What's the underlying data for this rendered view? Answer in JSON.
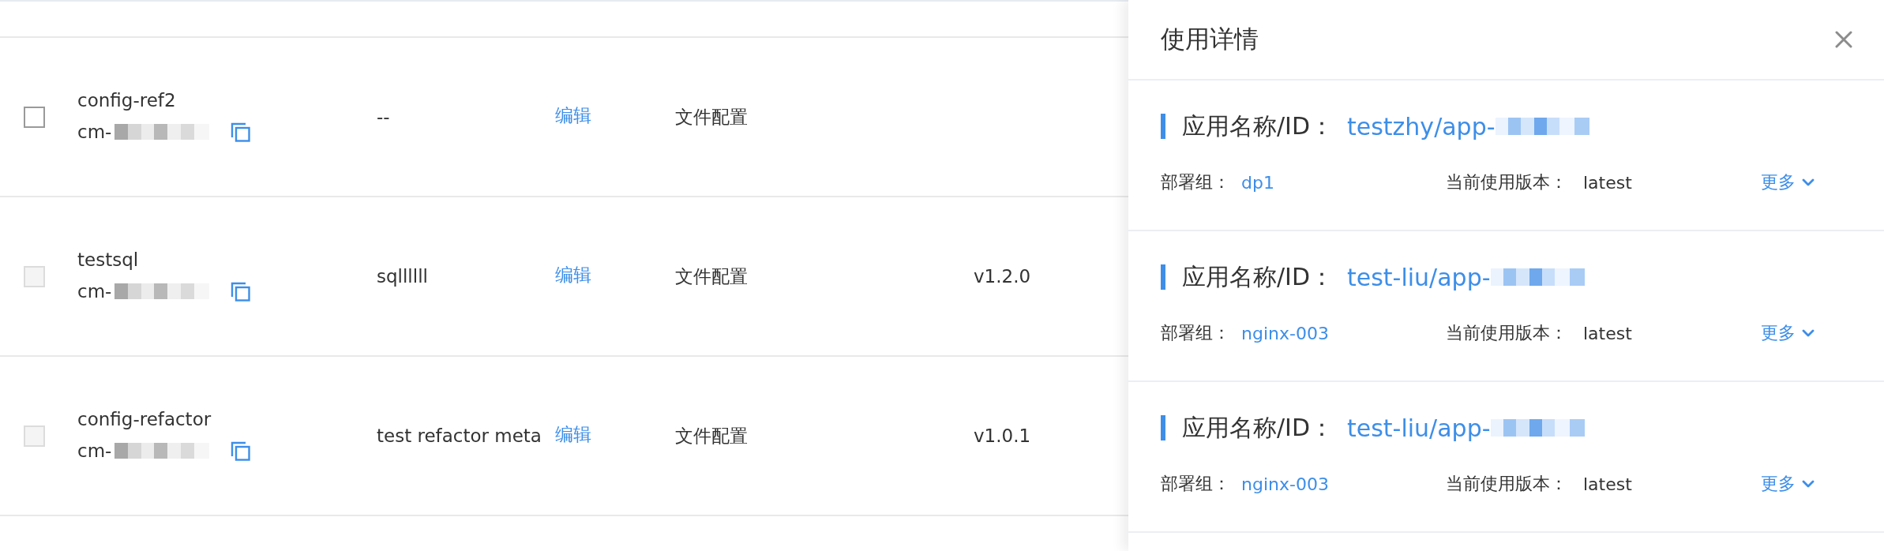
{
  "table": {
    "rows": [
      {
        "checked": false,
        "disabled": false,
        "name": "config-ref2",
        "id": "cm-",
        "description": "--",
        "action": "编辑",
        "type": "文件配置"
      },
      {
        "checked": false,
        "disabled": true,
        "name": "testsql",
        "id": "cm-",
        "description": "sqllllll",
        "action": "编辑",
        "type": "文件配置",
        "version": "v1.2.0"
      },
      {
        "checked": false,
        "disabled": true,
        "name": "config-refactor",
        "id": "cm-",
        "description": "test refactor meta",
        "action": "编辑",
        "type": "文件配置",
        "version": "v1.0.1"
      }
    ]
  },
  "drawer": {
    "title": "使用详情",
    "items": [
      {
        "label": "应用名称/ID：",
        "app": "testzhy/app-",
        "group_label": "部署组：",
        "group": "dp1",
        "version_label": "当前使用版本：",
        "version": "latest",
        "more": "更多"
      },
      {
        "label": "应用名称/ID：",
        "app": "test-liu/app-",
        "group_label": "部署组：",
        "group": "nginx-003",
        "version_label": "当前使用版本：",
        "version": "latest",
        "more": "更多"
      },
      {
        "label": "应用名称/ID：",
        "app": "test-liu/app-",
        "group_label": "部署组：",
        "group": "nginx-003",
        "version_label": "当前使用版本：",
        "version": "latest",
        "more": "更多"
      }
    ]
  }
}
